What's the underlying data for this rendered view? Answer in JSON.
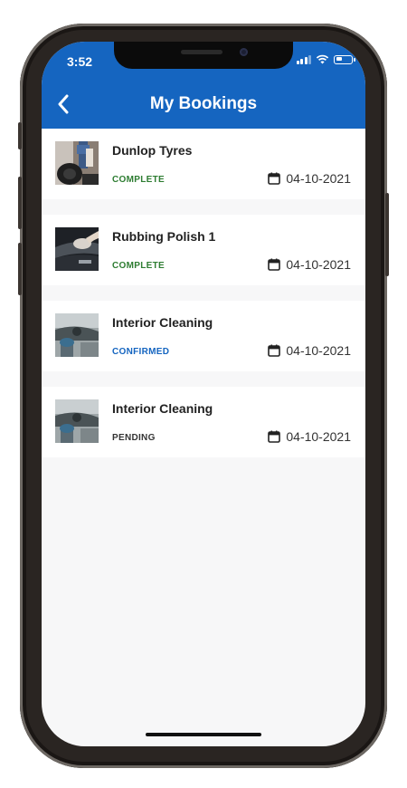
{
  "status_bar": {
    "time": "3:52",
    "battery_level": 0.45
  },
  "header": {
    "title": "My Bookings",
    "back_icon": "chevron-left-icon"
  },
  "colors": {
    "header_bg": "#1565c0",
    "status_complete": "#2e7d32",
    "status_confirmed": "#1565c0",
    "status_pending": "#333333"
  },
  "bookings": [
    {
      "title": "Dunlop Tyres",
      "status": "COMPLETE",
      "date": "04-10-2021",
      "thumb": "tyres"
    },
    {
      "title": "Rubbing Polish 1",
      "status": "COMPLETE",
      "date": "04-10-2021",
      "thumb": "polish"
    },
    {
      "title": "Interior Cleaning",
      "status": "CONFIRMED",
      "date": "04-10-2021",
      "thumb": "interior"
    },
    {
      "title": "Interior Cleaning",
      "status": "PENDING",
      "date": "04-10-2021",
      "thumb": "interior"
    }
  ]
}
